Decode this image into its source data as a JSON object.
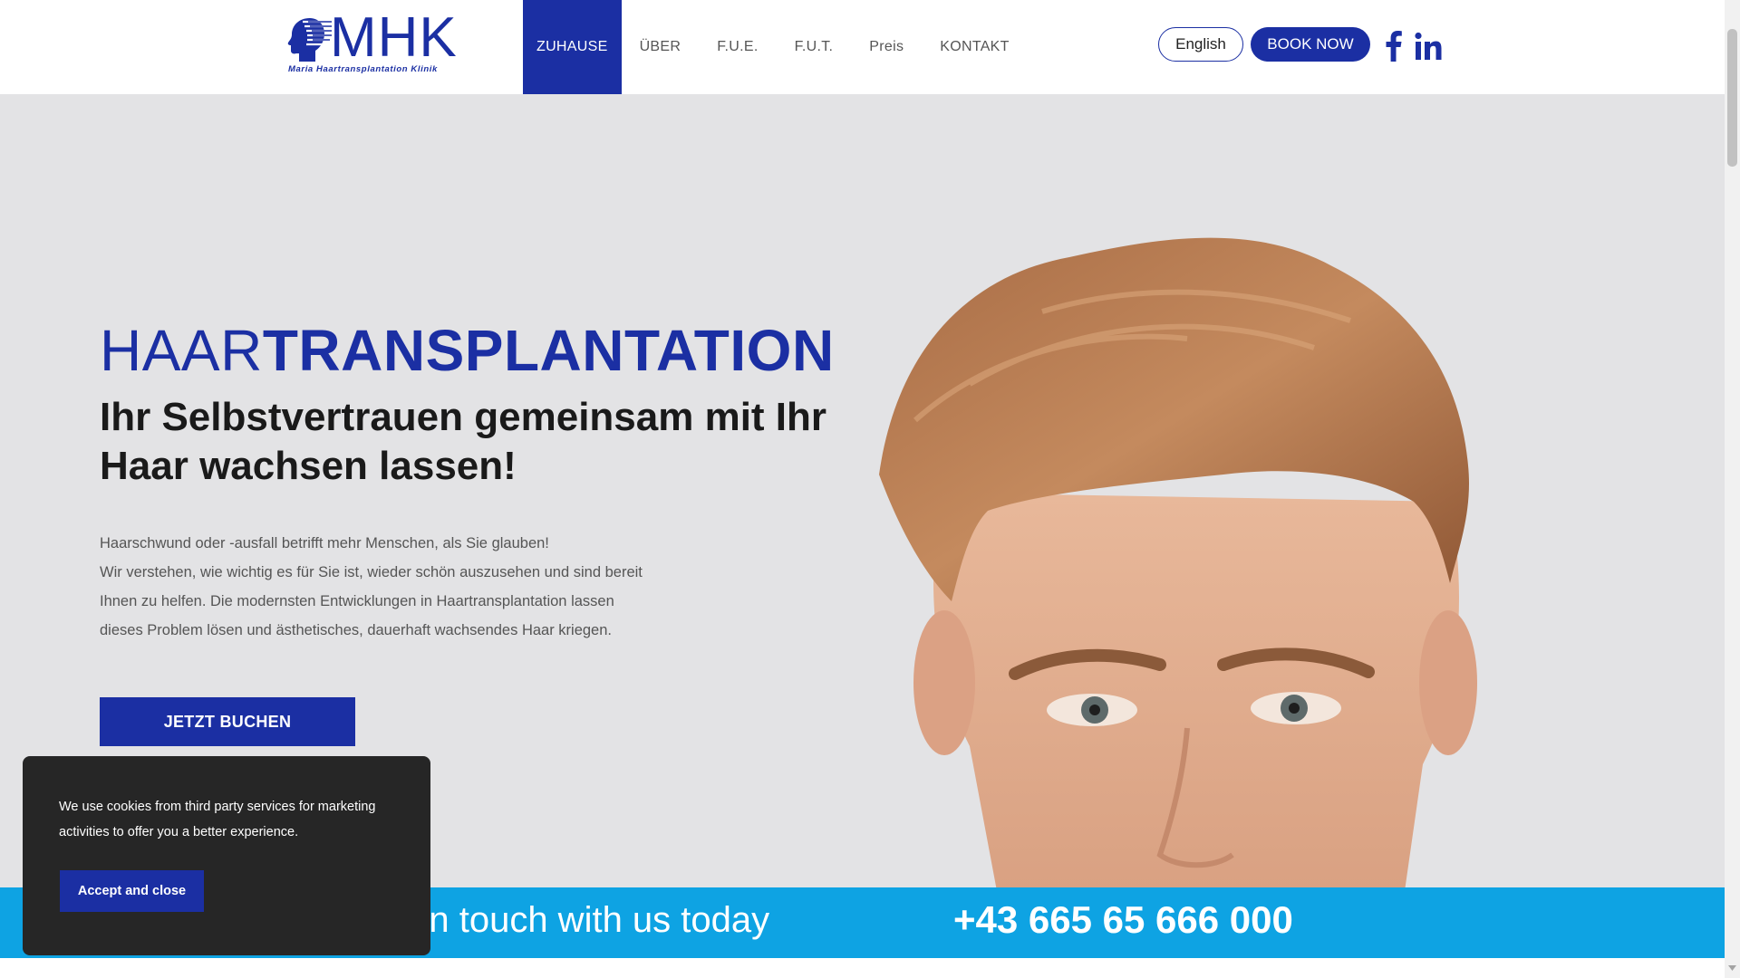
{
  "colors": {
    "brand": "#1b2fa3",
    "accent": "#0ea3e3",
    "hero_bg": "#e3e3e5",
    "cookie_bg": "#262626"
  },
  "header": {
    "logo": {
      "letters": "MHK",
      "tagline": "Maria Haartransplantation Klinik"
    },
    "nav": [
      {
        "label": "ZUHAUSE",
        "active": true
      },
      {
        "label": "ÜBER",
        "active": false
      },
      {
        "label": "F.U.E.",
        "active": false
      },
      {
        "label": "F.U.T.",
        "active": false
      },
      {
        "label": "Preis",
        "active": false
      },
      {
        "label": "KONTAKT",
        "active": false
      }
    ],
    "language_button": "English",
    "book_button": "BOOK NOW",
    "social_icons": [
      "facebook-icon",
      "linkedin-icon"
    ]
  },
  "hero": {
    "title_light": "HAAR",
    "title_bold": "TRANSPLANTATION",
    "subtitle": "Ihr Selbstvertrauen gemeinsam mit Ihr Haar wachsen lassen!",
    "text_lines": [
      "Haarschwund oder -ausfall betrifft mehr Menschen, als Sie glauben!",
      "Wir verstehen, wie wichtig es für Sie ist, wieder schön auszusehen und sind bereit",
      "Ihnen zu helfen. Die modernsten Entwicklungen in Haartransplantation lassen",
      "dieses Problem lösen und ästhetisches, dauerhaft wachsendes Haar kriegen."
    ],
    "cta": "JETZT BUCHEN"
  },
  "contact_bar": {
    "text": "et in touch with us today",
    "phone": "+43 665 65 666 000"
  },
  "cookie": {
    "text": "We use cookies from third party services for marketing activities to offer you a better experience.",
    "button": "Accept and close"
  }
}
